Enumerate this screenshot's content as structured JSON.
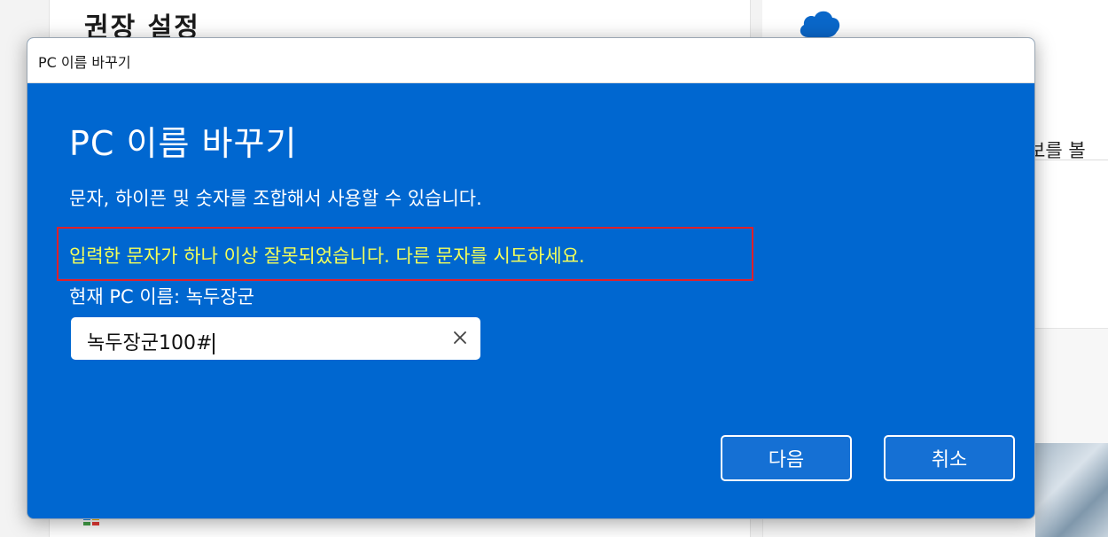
{
  "background": {
    "heading": "권장 설정",
    "right_text": "보를 볼 ",
    "cloud_icon": "cloud-icon",
    "windows_logo": "windows-logo-icon"
  },
  "dialog": {
    "window_title": "PC 이름 바꾸기",
    "heading": "PC 이름 바꾸기",
    "description": "문자, 하이픈 및 숫자를 조합해서 사용할 수 있습니다.",
    "error_message": "입력한 문자가 하나 이상 잘못되었습니다. 다른 문자를 시도하세요.",
    "current_name_label": "현재 PC 이름: 녹두장군",
    "input": {
      "value": "녹두장군100#",
      "clear_icon": "close-icon"
    },
    "buttons": {
      "next": "다음",
      "cancel": "취소"
    }
  },
  "colors": {
    "dialog_bg": "#0067d0",
    "error_text": "#f3ff5a",
    "highlight_border": "#e0202a"
  }
}
